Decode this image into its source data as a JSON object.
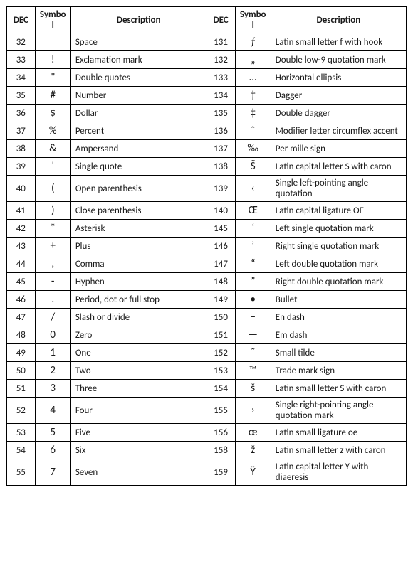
{
  "headers": {
    "dec": "DEC",
    "symbol": "Symbol",
    "description": "Description"
  },
  "rows": [
    {
      "left": {
        "dec": "32",
        "sym": " ",
        "desc": "Space"
      },
      "right": {
        "dec": "131",
        "sym": "ƒ",
        "desc": "Latin small letter f with hook"
      }
    },
    {
      "left": {
        "dec": "33",
        "sym": "!",
        "desc": "Exclamation mark"
      },
      "right": {
        "dec": "132",
        "sym": "„",
        "desc": "Double low-9 quotation mark"
      }
    },
    {
      "left": {
        "dec": "34",
        "sym": "\"",
        "desc": "Double quotes"
      },
      "right": {
        "dec": "133",
        "sym": "…",
        "desc": "Horizontal ellipsis"
      }
    },
    {
      "left": {
        "dec": "35",
        "sym": "#",
        "desc": "Number"
      },
      "right": {
        "dec": "134",
        "sym": "†",
        "desc": "Dagger"
      }
    },
    {
      "left": {
        "dec": "36",
        "sym": "$",
        "desc": "Dollar"
      },
      "right": {
        "dec": "135",
        "sym": "‡",
        "desc": "Double dagger"
      }
    },
    {
      "left": {
        "dec": "37",
        "sym": "%",
        "desc": "Percent"
      },
      "right": {
        "dec": "136",
        "sym": "ˆ",
        "desc": "Modifier letter circumflex accent"
      }
    },
    {
      "left": {
        "dec": "38",
        "sym": "&",
        "desc": "Ampersand"
      },
      "right": {
        "dec": "137",
        "sym": "‰",
        "desc": "Per mille sign"
      }
    },
    {
      "left": {
        "dec": "39",
        "sym": "'",
        "desc": "Single quote"
      },
      "right": {
        "dec": "138",
        "sym": "Š",
        "desc": "Latin capital letter S with caron"
      }
    },
    {
      "left": {
        "dec": "40",
        "sym": "(",
        "desc": "Open parenthesis"
      },
      "right": {
        "dec": "139",
        "sym": "‹",
        "desc": "Single left-pointing angle quotation"
      }
    },
    {
      "left": {
        "dec": "41",
        "sym": ")",
        "desc": "Close parenthesis"
      },
      "right": {
        "dec": "140",
        "sym": "Œ",
        "desc": "Latin capital ligature OE"
      }
    },
    {
      "left": {
        "dec": "42",
        "sym": "*",
        "desc": "Asterisk"
      },
      "right": {
        "dec": "145",
        "sym": "‘",
        "desc": "Left single quotation mark"
      }
    },
    {
      "left": {
        "dec": "43",
        "sym": "+",
        "desc": "Plus"
      },
      "right": {
        "dec": "146",
        "sym": "’",
        "desc": "Right single quotation mark"
      }
    },
    {
      "left": {
        "dec": "44",
        "sym": ",",
        "desc": "Comma"
      },
      "right": {
        "dec": "147",
        "sym": "“",
        "desc": "Left double quotation mark"
      }
    },
    {
      "left": {
        "dec": "45",
        "sym": "-",
        "desc": "Hyphen"
      },
      "right": {
        "dec": "148",
        "sym": "”",
        "desc": "Right double quotation mark"
      }
    },
    {
      "left": {
        "dec": "46",
        "sym": ".",
        "desc": "Period, dot or full stop"
      },
      "right": {
        "dec": "149",
        "sym": "•",
        "desc": "Bullet"
      }
    },
    {
      "left": {
        "dec": "47",
        "sym": "/",
        "desc": "Slash or divide"
      },
      "right": {
        "dec": "150",
        "sym": "–",
        "desc": "En dash"
      }
    },
    {
      "left": {
        "dec": "48",
        "sym": "0",
        "desc": "Zero"
      },
      "right": {
        "dec": "151",
        "sym": "—",
        "desc": "Em dash"
      }
    },
    {
      "left": {
        "dec": "49",
        "sym": "1",
        "desc": "One"
      },
      "right": {
        "dec": "152",
        "sym": "˜",
        "desc": "Small tilde"
      }
    },
    {
      "left": {
        "dec": "50",
        "sym": "2",
        "desc": "Two"
      },
      "right": {
        "dec": "153",
        "sym": "™",
        "desc": "Trade mark sign"
      }
    },
    {
      "left": {
        "dec": "51",
        "sym": "3",
        "desc": "Three"
      },
      "right": {
        "dec": "154",
        "sym": "š",
        "desc": "Latin small letter S with caron"
      }
    },
    {
      "left": {
        "dec": "52",
        "sym": "4",
        "desc": "Four"
      },
      "right": {
        "dec": "155",
        "sym": "›",
        "desc": "Single right-pointing angle quotation mark"
      }
    },
    {
      "left": {
        "dec": "53",
        "sym": "5",
        "desc": "Five"
      },
      "right": {
        "dec": "156",
        "sym": "œ",
        "desc": "Latin small ligature oe"
      }
    },
    {
      "left": {
        "dec": "54",
        "sym": "6",
        "desc": "Six"
      },
      "right": {
        "dec": "158",
        "sym": "ž",
        "desc": "Latin small letter z with caron"
      }
    },
    {
      "left": {
        "dec": "55",
        "sym": "7",
        "desc": "Seven"
      },
      "right": {
        "dec": "159",
        "sym": "Ÿ",
        "desc": "Latin capital letter Y with diaeresis"
      }
    }
  ]
}
